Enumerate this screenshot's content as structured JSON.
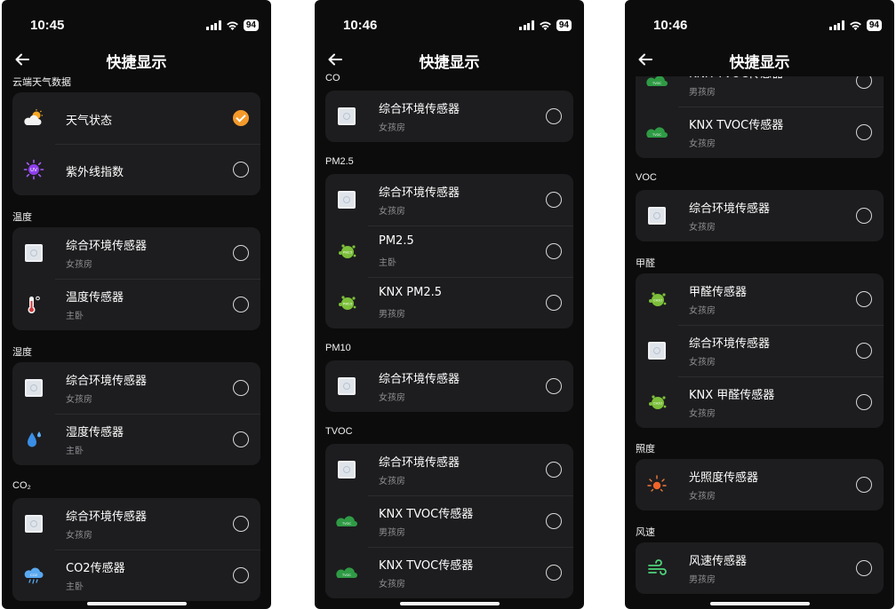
{
  "phones": [
    {
      "time": "10:45",
      "battery": "94",
      "title": "快捷显示",
      "sections": [
        {
          "header": "云端天气数据",
          "items": [
            {
              "title": "天气状态",
              "icon": "weather-cloud-sun-icon",
              "checked": true
            },
            {
              "title": "紫外线指数",
              "icon": "uv-index-icon",
              "checked": false
            }
          ]
        },
        {
          "header": "温度",
          "items": [
            {
              "title": "综合环境传感器",
              "subtitle": "女孩房",
              "icon": "environment-sensor-icon",
              "checked": false
            },
            {
              "title": "温度传感器",
              "subtitle": "主卧",
              "icon": "thermometer-icon",
              "checked": false
            }
          ]
        },
        {
          "header": "湿度",
          "items": [
            {
              "title": "综合环境传感器",
              "subtitle": "女孩房",
              "icon": "environment-sensor-icon",
              "checked": false
            },
            {
              "title": "湿度传感器",
              "subtitle": "主卧",
              "icon": "water-drop-icon",
              "checked": false
            }
          ]
        },
        {
          "header": "CO₂",
          "items": [
            {
              "title": "综合环境传感器",
              "subtitle": "女孩房",
              "icon": "environment-sensor-icon",
              "checked": false
            },
            {
              "title": "CO2传感器",
              "subtitle": "主卧",
              "icon": "co2-cloud-icon",
              "checked": false
            }
          ]
        }
      ]
    },
    {
      "time": "10:46",
      "battery": "94",
      "title": "快捷显示",
      "sections": [
        {
          "header": "CO",
          "items": [
            {
              "title": "综合环境传感器",
              "subtitle": "女孩房",
              "icon": "environment-sensor-icon",
              "checked": false
            }
          ]
        },
        {
          "header": "PM2.5",
          "items": [
            {
              "title": "综合环境传感器",
              "subtitle": "女孩房",
              "icon": "environment-sensor-icon",
              "checked": false
            },
            {
              "title": "PM2.5",
              "subtitle": "主卧",
              "icon": "pm25-sensor-icon",
              "checked": false
            },
            {
              "title": "KNX PM2.5",
              "subtitle": "男孩房",
              "icon": "pm25-sensor-icon",
              "checked": false
            }
          ]
        },
        {
          "header": "PM10",
          "items": [
            {
              "title": "综合环境传感器",
              "subtitle": "女孩房",
              "icon": "environment-sensor-icon",
              "checked": false
            }
          ]
        },
        {
          "header": "TVOC",
          "items": [
            {
              "title": "综合环境传感器",
              "subtitle": "女孩房",
              "icon": "environment-sensor-icon",
              "checked": false
            },
            {
              "title": "KNX TVOC传感器",
              "subtitle": "男孩房",
              "icon": "tvoc-cloud-icon",
              "checked": false
            },
            {
              "title": "KNX TVOC传感器",
              "subtitle": "女孩房",
              "icon": "tvoc-cloud-icon",
              "checked": false
            }
          ]
        }
      ]
    },
    {
      "time": "10:46",
      "battery": "94",
      "title": "快捷显示",
      "sections": [
        {
          "header": "",
          "items": [
            {
              "title": "KNX TVOC传感器",
              "subtitle": "男孩房",
              "icon": "tvoc-cloud-icon",
              "checked": false
            },
            {
              "title": "KNX TVOC传感器",
              "subtitle": "女孩房",
              "icon": "tvoc-cloud-icon",
              "checked": false
            }
          ]
        },
        {
          "header": "VOC",
          "items": [
            {
              "title": "综合环境传感器",
              "subtitle": "女孩房",
              "icon": "environment-sensor-icon",
              "checked": false
            }
          ]
        },
        {
          "header": "甲醛",
          "items": [
            {
              "title": "甲醛传感器",
              "subtitle": "女孩房",
              "icon": "formaldehyde-sensor-icon",
              "checked": false
            },
            {
              "title": "综合环境传感器",
              "subtitle": "女孩房",
              "icon": "environment-sensor-icon",
              "checked": false
            },
            {
              "title": "KNX 甲醛传感器",
              "subtitle": "女孩房",
              "icon": "formaldehyde-sensor-icon",
              "checked": false
            }
          ]
        },
        {
          "header": "照度",
          "items": [
            {
              "title": "光照度传感器",
              "subtitle": "女孩房",
              "icon": "light-sensor-icon",
              "checked": false
            }
          ]
        },
        {
          "header": "风速",
          "items": [
            {
              "title": "风速传感器",
              "subtitle": "男孩房",
              "icon": "wind-icon",
              "checked": false
            }
          ]
        }
      ]
    }
  ],
  "colors": {
    "background": "#0c0c0c",
    "card": "#1d1d1f",
    "accent": "#f39a2b",
    "subtitle": "#8e8e93"
  }
}
